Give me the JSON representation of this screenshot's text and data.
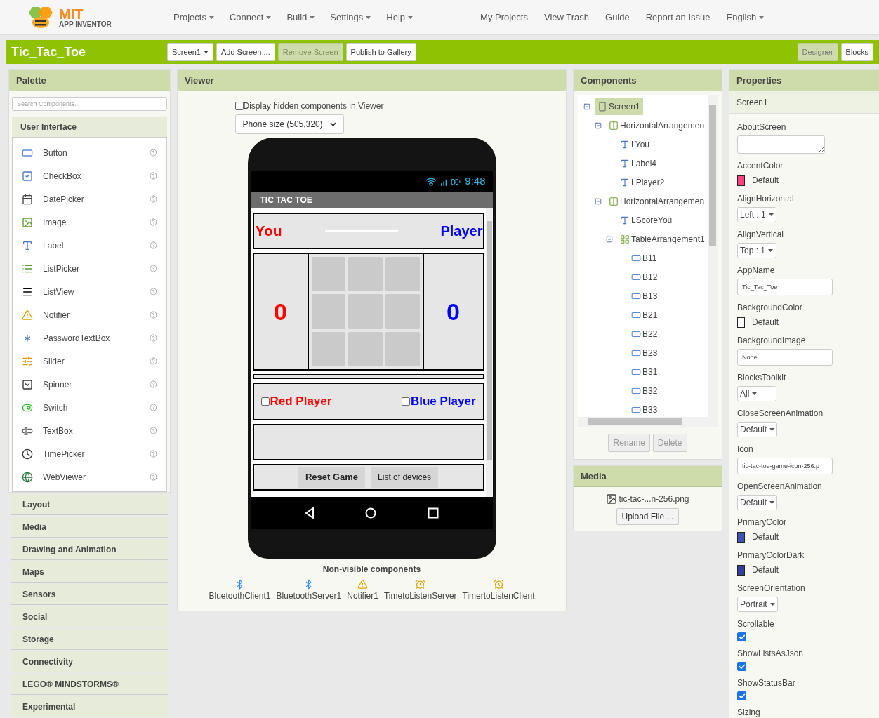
{
  "header": {
    "logo": {
      "line1": "MIT",
      "line2": "APP INVENTOR"
    },
    "menus": [
      {
        "label": "Projects"
      },
      {
        "label": "Connect"
      },
      {
        "label": "Build"
      },
      {
        "label": "Settings"
      },
      {
        "label": "Help"
      }
    ],
    "links": [
      "My Projects",
      "View Trash",
      "Guide",
      "Report an Issue"
    ],
    "language": "English"
  },
  "project_bar": {
    "title": "Tic_Tac_Toe",
    "buttons": [
      {
        "label": "Screen1",
        "kind": "dropdown",
        "disabled": false
      },
      {
        "label": "Add Screen ...",
        "kind": "button",
        "disabled": false
      },
      {
        "label": "Remove Screen",
        "kind": "button",
        "disabled": true
      },
      {
        "label": "Publish to Gallery",
        "kind": "button",
        "disabled": false
      }
    ],
    "views": [
      {
        "label": "Designer",
        "selected": true
      },
      {
        "label": "Blocks",
        "selected": false
      }
    ]
  },
  "palette": {
    "title": "Palette",
    "search": {
      "placeholder": "Search Components..."
    },
    "section": "User Interface",
    "items": [
      "Button",
      "CheckBox",
      "DatePicker",
      "Image",
      "Label",
      "ListPicker",
      "ListView",
      "Notifier",
      "PasswordTextBox",
      "Slider",
      "Spinner",
      "Switch",
      "TextBox",
      "TimePicker",
      "WebViewer"
    ],
    "categories": [
      "Layout",
      "Media",
      "Drawing and Animation",
      "Maps",
      "Sensors",
      "Social",
      "Storage",
      "Connectivity",
      "LEGO® MINDSTORMS®",
      "Experimental"
    ]
  },
  "viewer": {
    "title": "Viewer",
    "hidden_toggle": {
      "label": "Display hidden components in Viewer",
      "checked": false
    },
    "phone_size": "Phone size (505,320)",
    "phone": {
      "time": "9:48",
      "app_title": "TIC TAC TOE",
      "header_labels": [
        {
          "text": "You",
          "color": "#ff0000"
        },
        {
          "text": "Player",
          "color": "#0000ff"
        }
      ],
      "scores": [
        {
          "text": "0",
          "color": "#ff0000"
        },
        {
          "text": "0",
          "color": "#0000ff"
        }
      ],
      "players": [
        {
          "label": "Red Player",
          "color": "#ff0000",
          "checked": false
        },
        {
          "label": "Blue Player",
          "color": "#0000ff",
          "checked": false
        }
      ],
      "buttons": [
        "Reset Game",
        "List of devices"
      ]
    },
    "nonvisible_title": "Non-visible components",
    "nonvisible": [
      {
        "name": "BluetoothClient1",
        "kind": "bluetooth"
      },
      {
        "name": "BluetoothServer1",
        "kind": "bluetooth"
      },
      {
        "name": "Notifier1",
        "kind": "notifier"
      },
      {
        "name": "TimetoListenServer",
        "kind": "clock"
      },
      {
        "name": "TimertoListenClient",
        "kind": "clock"
      }
    ]
  },
  "components": {
    "title": "Components",
    "tree": [
      {
        "name": "Screen1",
        "kind": "screen",
        "selected": true,
        "expanded": true,
        "children": [
          {
            "name": "HorizontalArrangemen",
            "kind": "arrangement",
            "selected": false,
            "expanded": true,
            "children": [
              {
                "name": "LYou",
                "kind": "label",
                "selected": false
              },
              {
                "name": "Label4",
                "kind": "label",
                "selected": false
              },
              {
                "name": "LPlayer2",
                "kind": "label",
                "selected": false
              }
            ]
          },
          {
            "name": "HorizontalArrangemen",
            "kind": "arrangement",
            "selected": false,
            "expanded": true,
            "children": [
              {
                "name": "LScoreYou",
                "kind": "label",
                "selected": false
              },
              {
                "name": "TableArrangement1",
                "kind": "table",
                "selected": false,
                "expanded": true,
                "children": [
                  {
                    "name": "B11",
                    "kind": "button",
                    "selected": false
                  },
                  {
                    "name": "B12",
                    "kind": "button",
                    "selected": false
                  },
                  {
                    "name": "B13",
                    "kind": "button",
                    "selected": false
                  },
                  {
                    "name": "B21",
                    "kind": "button",
                    "selected": false
                  },
                  {
                    "name": "B22",
                    "kind": "button",
                    "selected": false
                  },
                  {
                    "name": "B23",
                    "kind": "button",
                    "selected": false
                  },
                  {
                    "name": "B31",
                    "kind": "button",
                    "selected": false
                  },
                  {
                    "name": "B32",
                    "kind": "button",
                    "selected": false
                  },
                  {
                    "name": "B33",
                    "kind": "button",
                    "selected": false
                  }
                ]
              }
            ]
          }
        ]
      }
    ],
    "buttons": [
      {
        "label": "Rename",
        "disabled": true
      },
      {
        "label": "Delete",
        "disabled": true
      }
    ]
  },
  "media": {
    "title": "Media",
    "files": [
      "tic-tac-...n-256.png"
    ],
    "upload": "Upload File ..."
  },
  "properties": {
    "title": "Properties",
    "component": "Screen1",
    "items": [
      {
        "label": "AboutScreen",
        "kind": "textarea"
      },
      {
        "label": "AccentColor",
        "kind": "color",
        "color": "#ff4081",
        "value": "Default"
      },
      {
        "label": "AlignHorizontal",
        "kind": "select",
        "value": "Left : 1"
      },
      {
        "label": "AlignVertical",
        "kind": "select",
        "value": "Top : 1"
      },
      {
        "label": "AppName",
        "kind": "text",
        "value": "Tic_Tac_Toe"
      },
      {
        "label": "BackgroundColor",
        "kind": "color",
        "color": "#ffffff",
        "value": "Default"
      },
      {
        "label": "BackgroundImage",
        "kind": "text",
        "value": "None..."
      },
      {
        "label": "BlocksToolkit",
        "kind": "select",
        "value": "All"
      },
      {
        "label": "CloseScreenAnimation",
        "kind": "select",
        "value": "Default"
      },
      {
        "label": "Icon",
        "kind": "text",
        "value": "tic-tac-toe-game-icon-256.p"
      },
      {
        "label": "OpenScreenAnimation",
        "kind": "select",
        "value": "Default"
      },
      {
        "label": "PrimaryColor",
        "kind": "color",
        "color": "#3f51b5",
        "value": "Default"
      },
      {
        "label": "PrimaryColorDark",
        "kind": "color",
        "color": "#303f9f",
        "value": "Default"
      },
      {
        "label": "ScreenOrientation",
        "kind": "select",
        "value": "Portrait"
      },
      {
        "label": "Scrollable",
        "kind": "checkbox",
        "checked": true
      },
      {
        "label": "ShowListsAsJson",
        "kind": "checkbox",
        "checked": true
      },
      {
        "label": "ShowStatusBar",
        "kind": "checkbox",
        "checked": true
      },
      {
        "label": "Sizing",
        "kind": "select"
      }
    ]
  }
}
